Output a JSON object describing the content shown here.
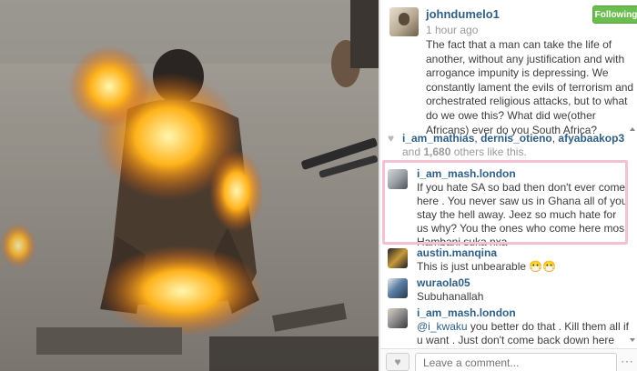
{
  "post": {
    "username": "johndumelo1",
    "time": "1 hour ago",
    "follow_label": "Following",
    "caption": "The fact that a man can take the life of another, without any justification and with arrogance impunity is depressing. We constantly lament the evils of terrorism and orchestrated religious attacks, but to what do we owe this? What did we(other Africans) ever do you South Africa?"
  },
  "likes": {
    "likers": [
      "i_am_mathias",
      "dernis_otieno",
      "afyabaakop3"
    ],
    "and_text": "and",
    "count": "1,680",
    "others_text": "others like this."
  },
  "comments": [
    {
      "user": "i_am_mash.london",
      "text": "If you hate SA so bad then don't ever come here . You never saw us in Ghana all of you stay the hell away. Jeez so much hate for us why? You the ones who come here mos. Hambani suka nxa"
    },
    {
      "user": "austin.manqina",
      "text": "This is just unbearable 😷😷"
    },
    {
      "user": "wuraola05",
      "text": "Subuhanallah"
    },
    {
      "user": "i_am_mash.london",
      "mention": "@i_kwaku",
      "text": " you better do that . Kill them all if u want . Just don't come back down here"
    }
  ],
  "footer": {
    "like_icon": "heart-icon",
    "placeholder": "Leave a comment...",
    "more_label": "⋯"
  },
  "colors": {
    "link": "#2f5f86",
    "follow_green": "#6bbd4f",
    "highlight_border": "#f3c2d0"
  }
}
